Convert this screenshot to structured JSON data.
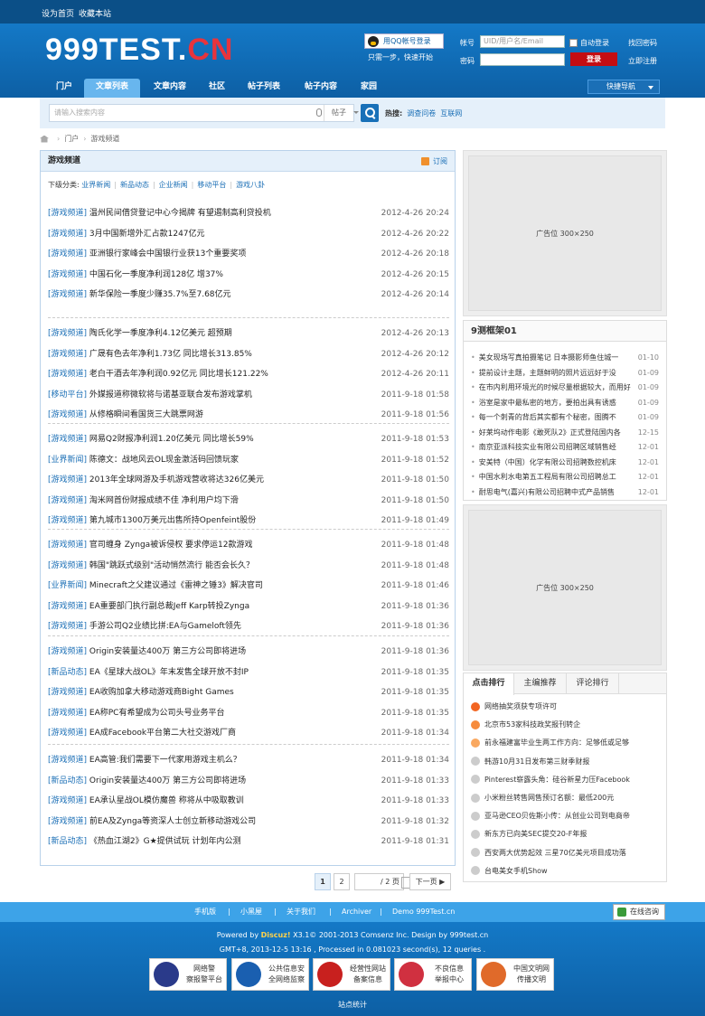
{
  "topbar": {
    "home": "设为首页",
    "fav": "收藏本站"
  },
  "logo": {
    "main": "999TEST.",
    "cn": "CN"
  },
  "login": {
    "qq_label": "用QQ帐号登录",
    "qq_tip": "只需一步，快速开始",
    "account_label": "帐号",
    "account_placeholder": "UID/用户名/Email",
    "password_label": "密码",
    "auto_login": "自动登录",
    "login_button": "登录",
    "find_password": "找回密码",
    "register": "立即注册"
  },
  "nav": {
    "items": [
      "门户",
      "文章列表",
      "文章内容",
      "社区",
      "帖子列表",
      "帖子内容",
      "家园"
    ],
    "active": "文章列表",
    "quick_nav": "快捷导航"
  },
  "search": {
    "placeholder": "请输入搜索内容",
    "type": "帖子",
    "hot_label": "热搜:",
    "hot": [
      "调查问卷",
      "互联网"
    ]
  },
  "breadcrumb": {
    "items": [
      "门户",
      "游戏频道"
    ]
  },
  "channel": {
    "title": "游戏频道",
    "subscribe": "订阅",
    "sub_label": "下级分类:",
    "sub_items": [
      "业界新闻",
      "新品动态",
      "企业新闻",
      "移动平台",
      "游戏八卦"
    ]
  },
  "articles": [
    [
      {
        "cat": "[游戏频道]",
        "title": "温州民间借贷登记中心今揭牌 有望遏制高利贷投机",
        "date": "2012-4-26 20:24"
      },
      {
        "cat": "[游戏频道]",
        "title": "3月中国新增外汇占款1247亿元",
        "date": "2012-4-26 20:22"
      },
      {
        "cat": "[游戏频道]",
        "title": "亚洲银行家峰会中国银行业获13个重要奖项",
        "date": "2012-4-26 20:18"
      },
      {
        "cat": "[游戏频道]",
        "title": "中国石化一季度净利润128亿 增37%",
        "date": "2012-4-26 20:15"
      },
      {
        "cat": "[游戏频道]",
        "title": "新华保险一季度少赚35.7%至7.68亿元",
        "date": "2012-4-26 20:14"
      }
    ],
    [
      {
        "cat": "[游戏频道]",
        "title": "陶氏化学一季度净利4.12亿美元 超预期",
        "date": "2012-4-26 20:13"
      },
      {
        "cat": "[游戏频道]",
        "title": "广晟有色去年净利1.73亿 同比增长313.85%",
        "date": "2012-4-26 20:12"
      },
      {
        "cat": "[游戏频道]",
        "title": "老白干酒去年净利润0.92亿元 同比增长121.22%",
        "date": "2012-4-26 20:11"
      },
      {
        "cat": "[移动平台]",
        "title": "外媒报道称微软将与诺基亚联合发布游戏掌机",
        "date": "2011-9-18 01:58"
      },
      {
        "cat": "[游戏频道]",
        "title": "从修格瞬间看国货三大跳票网游",
        "date": "2011-9-18 01:56"
      }
    ],
    [
      {
        "cat": "[游戏频道]",
        "title": "网易Q2财报净利润1.20亿美元 同比增长59%",
        "date": "2011-9-18 01:53"
      },
      {
        "cat": "[业界新闻]",
        "title": "陈德文：战地风云OL现金激活码回馈玩家",
        "date": "2011-9-18 01:52"
      },
      {
        "cat": "[游戏频道]",
        "title": "2013年全球网游及手机游戏营收将达326亿美元",
        "date": "2011-9-18 01:50"
      },
      {
        "cat": "[游戏频道]",
        "title": "淘米网首份财报成绩不佳 净利用户均下滑",
        "date": "2011-9-18 01:50"
      },
      {
        "cat": "[游戏频道]",
        "title": "第九城市1300万美元出售所持Openfeint股份",
        "date": "2011-9-18 01:49"
      }
    ],
    [
      {
        "cat": "[游戏频道]",
        "title": "官司缠身 Zynga被诉侵权 要求停运12款游戏",
        "date": "2011-9-18 01:48"
      },
      {
        "cat": "[游戏频道]",
        "title": "韩国\"跳跃式级别\"活动悄然流行 能否会长久？",
        "date": "2011-9-18 01:48"
      },
      {
        "cat": "[业界新闻]",
        "title": "Minecraft之父建议通过《雷神之锤3》解决官司",
        "date": "2011-9-18 01:46"
      },
      {
        "cat": "[游戏频道]",
        "title": "EA重要部门执行副总裁Jeff Karp转投Zynga",
        "date": "2011-9-18 01:36"
      },
      {
        "cat": "[游戏频道]",
        "title": "手游公司Q2业绩比拼:EA与Gameloft领先",
        "date": "2011-9-18 01:36"
      }
    ],
    [
      {
        "cat": "[游戏频道]",
        "title": "Origin安装量达400万 第三方公司即将进场",
        "date": "2011-9-18 01:36"
      },
      {
        "cat": "[新品动态]",
        "title": "EA《星球大战OL》年末发售全球开放不封IP",
        "date": "2011-9-18 01:35"
      },
      {
        "cat": "[游戏频道]",
        "title": "EA收购加拿大移动游戏商Bight Games",
        "date": "2011-9-18 01:35"
      },
      {
        "cat": "[游戏频道]",
        "title": "EA称PC有希望成为公司头号业务平台",
        "date": "2011-9-18 01:35"
      },
      {
        "cat": "[游戏频道]",
        "title": "EA成Facebook平台第二大社交游戏厂商",
        "date": "2011-9-18 01:34"
      }
    ],
    [
      {
        "cat": "[游戏频道]",
        "title": "EA高管:我们需要下一代家用游戏主机么？",
        "date": "2011-9-18 01:34"
      },
      {
        "cat": "[新品动态]",
        "title": "Origin安装量达400万 第三方公司即将进场",
        "date": "2011-9-18 01:33"
      },
      {
        "cat": "[游戏频道]",
        "title": "EA承认星战OL模仿魔兽 称将从中吸取教训",
        "date": "2011-9-18 01:33"
      },
      {
        "cat": "[游戏频道]",
        "title": "前EA及Zynga等资深人士创立新移动游戏公司",
        "date": "2011-9-18 01:32"
      },
      {
        "cat": "[新品动态]",
        "title": "《热血江湖2》G★提供试玩 计划年内公测",
        "date": "2011-9-18 01:31"
      }
    ]
  ],
  "pager": {
    "pages": [
      "1",
      "2"
    ],
    "current": "1",
    "input": "1",
    "total": "/ 2 页",
    "next": "下一页 ▶"
  },
  "side": {
    "ad1": "广告位 300×250",
    "ad2": "广告位 300×250",
    "frame_title": "9测框架01",
    "frame_items": [
      {
        "t": "美女现场写真拍摄笔记 日本摄影师鱼住城一",
        "d": "01-10"
      },
      {
        "t": "提前设计主题，主题鲜明的照片远远好于没",
        "d": "01-09"
      },
      {
        "t": "在市内利用环境光的时候尽量根据较大，而用好",
        "d": "01-09"
      },
      {
        "t": "浴室是家中最私密的地方，要拍出具有诱惑",
        "d": "01-09"
      },
      {
        "t": "每一个刺青的背后其实都有个秘密，图腾不",
        "d": "01-09"
      },
      {
        "t": "好莱坞动作电影《敢死队2》正式登陆国内各",
        "d": "12-15"
      },
      {
        "t": "南京亚派科技实业有限公司招聘区域销售经",
        "d": "12-01"
      },
      {
        "t": "安美特（中国）化学有限公司招聘数控机床",
        "d": "12-01"
      },
      {
        "t": "中国水利水电第五工程局有限公司招聘总工",
        "d": "12-01"
      },
      {
        "t": "耐思电气(嘉兴)有限公司招聘中式产品销售",
        "d": "12-01"
      }
    ],
    "rank_tabs": [
      "点击排行",
      "主编推荐",
      "评论排行"
    ],
    "rank_items": [
      "网络抽奖须获专项许可",
      "北京市53家科技政奖报刊转企",
      "前永福建富毕业生两工作方向：足够低或足够",
      "韩游10月31日发布第三财季财报",
      "Pinterest崭露头角：硅谷新星力压Facebook",
      "小米粉丝转售网售预订名额：最低200元",
      "亚马逊CEO贝佐斯小传：从创业公司到电商帝",
      "新东方已向美SEC提交20-F年报",
      "西安两大优势起效 三星70亿美元项目成功落",
      "台电美女手机Show"
    ]
  },
  "footer_nav": {
    "links": [
      "手机版",
      "小黑屋",
      "关于我们",
      "Archiver",
      "Demo 999Test.cn"
    ],
    "online": "在线咨询"
  },
  "footer": {
    "powered_prefix": "Powered by ",
    "powered_brand": "Discuz!",
    "powered_rest": " X3.1© 2001-2013 Comsenz Inc. Design by 999test.cn",
    "stats": "GMT+8, 2013-12-5 13:16 , Processed in 0.081023 second(s), 12 queries .",
    "stat_link": "站点统计",
    "badges": [
      {
        "l1": "网络警",
        "l2": "察报警平台"
      },
      {
        "l1": "公共信息安",
        "l2": "全网络监察"
      },
      {
        "l1": "经营性网站",
        "l2": "备案信息"
      },
      {
        "l1": "不良信息",
        "l2": "举报中心"
      },
      {
        "l1": "中国文明网",
        "l2": "传播文明"
      }
    ]
  },
  "colors": {
    "header_blue": "#1479c7",
    "link_blue": "#1b6fb6",
    "login_red": "#c40d12",
    "logo_red": "#e8343c"
  }
}
